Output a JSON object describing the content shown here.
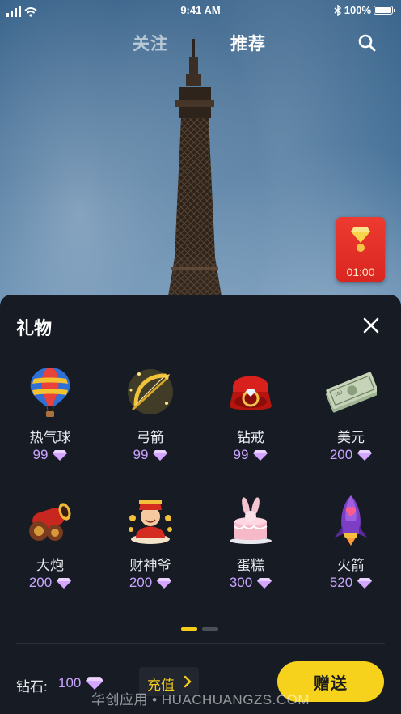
{
  "status_bar": {
    "time": "9:41 AM",
    "battery": "100%"
  },
  "nav": {
    "tabs": [
      {
        "label": "关注"
      },
      {
        "label": "推荐",
        "active": true
      }
    ],
    "search_icon": "search-icon"
  },
  "red_packet": {
    "timer": "01:00",
    "icon": "red-packet-icon"
  },
  "gift_panel": {
    "title": "礼物",
    "gifts": [
      {
        "name": "热气球",
        "price": "99",
        "icon": "hot-air-balloon-icon"
      },
      {
        "name": "弓箭",
        "price": "99",
        "icon": "bow-arrow-icon"
      },
      {
        "name": "钻戒",
        "price": "99",
        "icon": "diamond-ring-icon"
      },
      {
        "name": "美元",
        "price": "200",
        "icon": "dollar-bills-icon"
      },
      {
        "name": "大炮",
        "price": "200",
        "icon": "cannon-icon"
      },
      {
        "name": "财神爷",
        "price": "200",
        "icon": "god-of-wealth-icon"
      },
      {
        "name": "蛋糕",
        "price": "300",
        "icon": "cake-icon"
      },
      {
        "name": "火箭",
        "price": "520",
        "icon": "rocket-icon"
      }
    ],
    "page_count": 2,
    "current_page": 1
  },
  "footer": {
    "balance_label": "钻石:",
    "balance_value": "100",
    "recharge_label": "充值",
    "send_label": "赠送"
  },
  "watermark": "华创应用 • HUACHUANGZS.COM",
  "colors": {
    "accent": "#f7d21c",
    "price": "#c9a4ff",
    "panel": "#161b24",
    "red_packet": "#e5302a"
  }
}
